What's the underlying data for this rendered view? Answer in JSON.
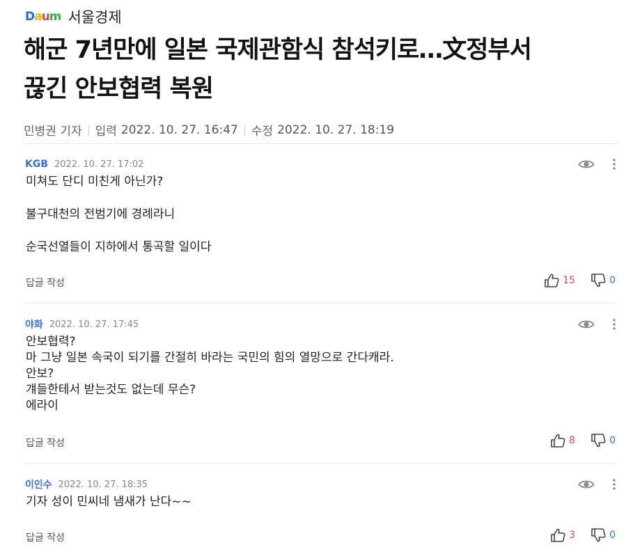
{
  "header": {
    "logo_text": "Daum",
    "press_name": "서울경제",
    "colors": {
      "logo_blue": "#1f6ee6",
      "logo_yellow": "#f2b400",
      "logo_red": "#e8413a",
      "logo_green": "#2fb344"
    }
  },
  "article": {
    "headline_line1": "해군 7년만에 일본 국제관함식 참석키로…文정부서",
    "headline_line2": "끊긴 안보협력 복원",
    "reporter": "민병권 기자",
    "input_label": "입력",
    "input_time": "2022. 10. 27. 16:47",
    "edit_label": "수정",
    "edit_time": "2022. 10. 27. 18:19"
  },
  "comments": [
    {
      "author": "KGB",
      "time": "2022. 10. 27. 17:02",
      "body": "미쳐도 단디 미친게 아닌가?\n\n불구대천의 전범기에 경례라니\n\n순국선열들이 지하에서 통곡할 일이다",
      "reply_label": "답글 작성",
      "likes": "15",
      "dislikes": "0"
    },
    {
      "author": "야화",
      "time": "2022. 10. 27. 17:45",
      "body": "안보협력?\n마 그냥 일본 속국이 되기를 간절히 바라는 국민의 힘의 열망으로 간다캐라.\n안보?\n걔들한테서 받는것도 없는데 무슨?\n에라이",
      "reply_label": "답글 작성",
      "likes": "8",
      "dislikes": "0"
    },
    {
      "author": "이인수",
      "time": "2022. 10. 27. 18:35",
      "body": "기자 성이 민씨네 냄새가 난다~~",
      "reply_label": "답글 작성",
      "likes": "3",
      "dislikes": "0"
    }
  ],
  "icons": {
    "eye": "eye-icon",
    "more": "more-vertical-icon",
    "like": "thumbs-up-icon",
    "dislike": "thumbs-down-icon"
  },
  "accent_colors": {
    "author": "#3b6fd6",
    "likes": "#e5484d",
    "dislikes": "#3b6fd6"
  }
}
